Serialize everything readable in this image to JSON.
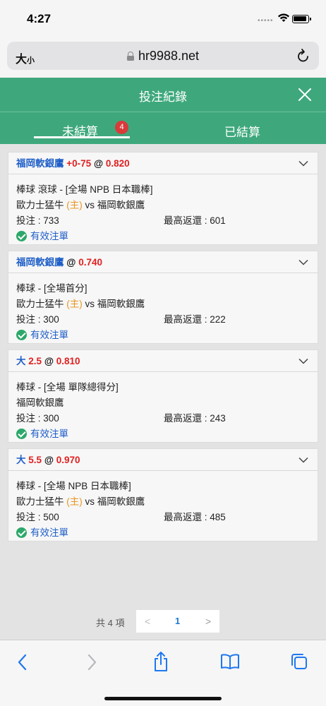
{
  "status_bar": {
    "time": "4:27"
  },
  "browser": {
    "text_size_label": "大",
    "text_size_small": "小",
    "url": "hr9988.net"
  },
  "header": {
    "title": "投注紀錄"
  },
  "tabs": [
    {
      "label": "未結算",
      "badge": "4"
    },
    {
      "label": "已結算"
    }
  ],
  "bets": [
    {
      "team": "福岡軟銀鷹",
      "handicap": "+0-75",
      "at": "@",
      "odds": "0.820",
      "line1": "棒球 滾球 - [全場 NPB 日本職棒]",
      "home_team": "歐力士猛牛",
      "home_tag": "(主)",
      "vs": "vs",
      "away_team": "福岡軟銀鷹",
      "stake": "投注 : 733",
      "max_return": "最高返還 : 601",
      "status": "有效注單"
    },
    {
      "team": "福岡軟銀鷹",
      "handicap": "",
      "at": "@",
      "odds": "0.740",
      "line1": "棒球 - [全場首分]",
      "home_team": "歐力士猛牛",
      "home_tag": "(主)",
      "vs": "vs",
      "away_team": "福岡軟銀鷹",
      "stake": "投注 : 300",
      "max_return": "最高返還 : 222",
      "status": "有效注單"
    },
    {
      "team": "大",
      "handicap": "2.5",
      "at": "@",
      "odds": "0.810",
      "line1": "棒球 - [全場 單隊總得分]",
      "home_team": "福岡軟銀鷹",
      "home_tag": "",
      "vs": "",
      "away_team": "",
      "stake": "投注 : 300",
      "max_return": "最高返還 : 243",
      "status": "有效注單"
    },
    {
      "team": "大",
      "handicap": "5.5",
      "at": "@",
      "odds": "0.970",
      "line1": "棒球 - [全場 NPB 日本職棒]",
      "home_team": "歐力士猛牛",
      "home_tag": "(主)",
      "vs": "vs",
      "away_team": "福岡軟銀鷹",
      "stake": "投注 : 500",
      "max_return": "最高返還 : 485",
      "status": "有效注單"
    }
  ],
  "pagination": {
    "total": "共 4 項",
    "prev": "<",
    "page": "1",
    "next": ">"
  },
  "colors": {
    "header_green": "#3ea87c",
    "team_blue": "#1e5ec8",
    "odds_red": "#e02020",
    "home_orange": "#e8961e",
    "valid_green": "#2ca86a",
    "badge_red": "#d93a3a"
  },
  "icons": [
    "wifi-icon",
    "battery-icon",
    "lock-icon",
    "reload-icon",
    "close-icon",
    "chevron-down-icon",
    "check-circle-icon",
    "back-icon",
    "forward-icon",
    "share-icon",
    "bookmarks-icon",
    "tabs-icon"
  ]
}
